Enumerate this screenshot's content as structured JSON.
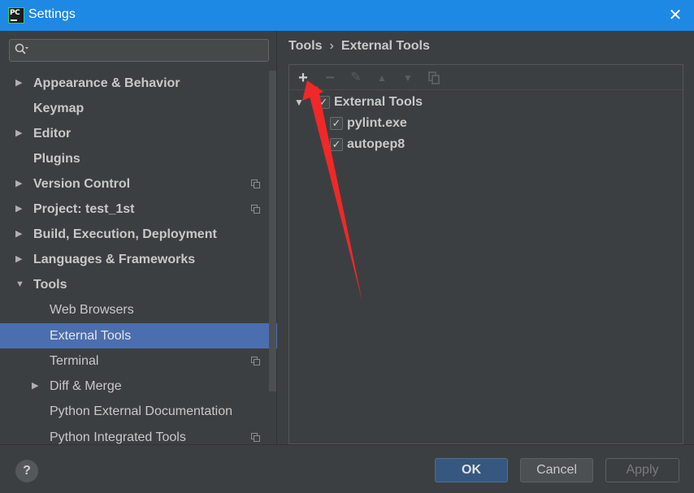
{
  "window": {
    "title": "Settings",
    "close_glyph": "✕",
    "app_icon": "pycharm-icon",
    "app_icon_text": "PC"
  },
  "search": {
    "value": "",
    "placeholder": ""
  },
  "sidebar": {
    "items": [
      {
        "label": "Appearance & Behavior",
        "arrow": "▶"
      },
      {
        "label": "Keymap",
        "arrow": ""
      },
      {
        "label": "Editor",
        "arrow": "▶"
      },
      {
        "label": "Plugins",
        "arrow": ""
      },
      {
        "label": "Version Control",
        "arrow": "▶"
      },
      {
        "label": "Project: test_1st",
        "arrow": "▶"
      },
      {
        "label": "Build, Execution, Deployment",
        "arrow": "▶"
      },
      {
        "label": "Languages & Frameworks",
        "arrow": "▶"
      },
      {
        "label": "Tools",
        "arrow": "▼"
      },
      {
        "label": "Web Browsers",
        "arrow": ""
      },
      {
        "label": "External Tools",
        "arrow": ""
      },
      {
        "label": "Terminal",
        "arrow": ""
      },
      {
        "label": "Diff & Merge",
        "arrow": "▶"
      },
      {
        "label": "Python External Documentation",
        "arrow": ""
      },
      {
        "label": "Python Integrated Tools",
        "arrow": ""
      }
    ]
  },
  "breadcrumb": {
    "parent": "Tools",
    "separator": "›",
    "current": "External Tools"
  },
  "toolbar": {
    "add": "+",
    "remove": "−",
    "edit": "✎",
    "up": "▲",
    "down": "▼"
  },
  "tools_tree": {
    "group": {
      "label": "External Tools",
      "arrow": "▼",
      "checked": "✓"
    },
    "children": [
      {
        "label": "pylint.exe",
        "checked": "✓"
      },
      {
        "label": "autopep8",
        "checked": "✓"
      }
    ]
  },
  "buttons": {
    "help": "?",
    "ok": "OK",
    "cancel": "Cancel",
    "apply": "Apply"
  },
  "colors": {
    "titlebar": "#1e88e5",
    "background": "#3c3f41",
    "selection": "#4b6eaf",
    "annotation": "#f02828",
    "ok_button": "#365880"
  }
}
